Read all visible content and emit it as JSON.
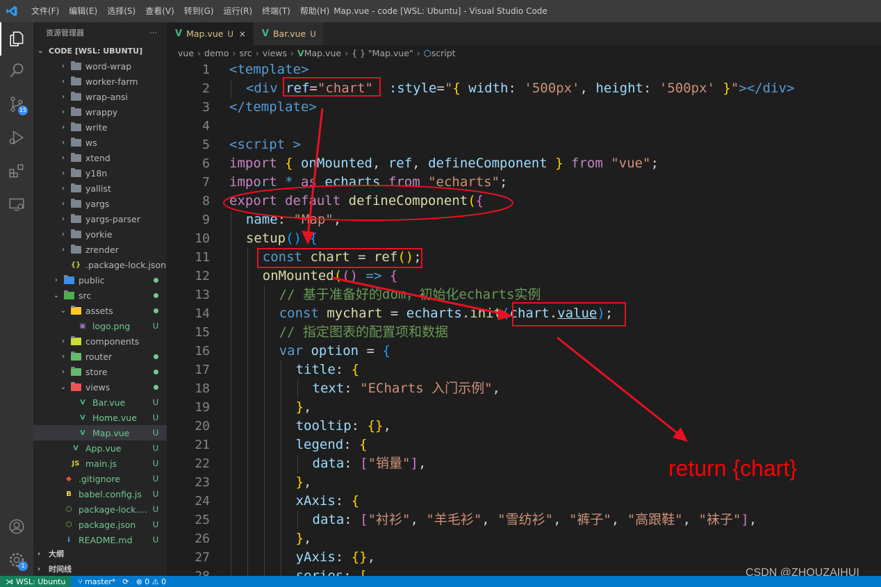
{
  "window": {
    "title": "Map.vue - code [WSL: Ubuntu] - Visual Studio Code",
    "menu": [
      "文件(F)",
      "编辑(E)",
      "选择(S)",
      "查看(V)",
      "转到(G)",
      "运行(R)",
      "终端(T)",
      "帮助(H)"
    ]
  },
  "activity": {
    "scm_badge": "15",
    "settings_badge": "1"
  },
  "sidebar": {
    "title": "资源管理器",
    "more": "···",
    "root": "CODE [WSL: UBUNTU]",
    "items": [
      {
        "name": "word-wrap",
        "type": "folder",
        "indent": 1
      },
      {
        "name": "worker-farm",
        "type": "folder",
        "indent": 1
      },
      {
        "name": "wrap-ansi",
        "type": "folder",
        "indent": 1
      },
      {
        "name": "wrappy",
        "type": "folder",
        "indent": 1
      },
      {
        "name": "write",
        "type": "folder",
        "indent": 1
      },
      {
        "name": "ws",
        "type": "folder",
        "indent": 1
      },
      {
        "name": "xtend",
        "type": "folder",
        "indent": 1
      },
      {
        "name": "y18n",
        "type": "folder",
        "indent": 1
      },
      {
        "name": "yallist",
        "type": "folder",
        "indent": 1
      },
      {
        "name": "yargs",
        "type": "folder",
        "indent": 1
      },
      {
        "name": "yargs-parser",
        "type": "folder",
        "indent": 1
      },
      {
        "name": "yorkie",
        "type": "folder",
        "indent": 1
      },
      {
        "name": "zrender",
        "type": "folder",
        "indent": 1
      },
      {
        "name": ".package-lock.json",
        "type": "json",
        "indent": 1
      },
      {
        "name": "public",
        "type": "folder-public",
        "indent": 0,
        "dot": true
      },
      {
        "name": "src",
        "type": "folder-src",
        "indent": 0,
        "open": true,
        "dot": true
      },
      {
        "name": "assets",
        "type": "folder-assets",
        "indent": 1,
        "open": true,
        "dot": true
      },
      {
        "name": "logo.png",
        "type": "image",
        "indent": 2,
        "badge": "U"
      },
      {
        "name": "components",
        "type": "folder-components",
        "indent": 1
      },
      {
        "name": "router",
        "type": "folder-router",
        "indent": 1,
        "dot": true
      },
      {
        "name": "store",
        "type": "folder-store",
        "indent": 1,
        "dot": true
      },
      {
        "name": "views",
        "type": "folder-views",
        "indent": 1,
        "open": true,
        "dot": true
      },
      {
        "name": "Bar.vue",
        "type": "vue",
        "indent": 2,
        "badge": "U"
      },
      {
        "name": "Home.vue",
        "type": "vue",
        "indent": 2,
        "badge": "U"
      },
      {
        "name": "Map.vue",
        "type": "vue",
        "indent": 2,
        "badge": "U",
        "selected": true
      },
      {
        "name": "App.vue",
        "type": "vue",
        "indent": 1,
        "badge": "U"
      },
      {
        "name": "main.js",
        "type": "js",
        "indent": 1,
        "badge": "U"
      },
      {
        "name": ".gitignore",
        "type": "git",
        "indent": 0,
        "badge": "U"
      },
      {
        "name": "babel.config.js",
        "type": "babel",
        "indent": 0,
        "badge": "U"
      },
      {
        "name": "package-lock.js...",
        "type": "npm",
        "indent": 0,
        "badge": "U"
      },
      {
        "name": "package.json",
        "type": "npm",
        "indent": 0,
        "badge": "U"
      },
      {
        "name": "README.md",
        "type": "info",
        "indent": 0,
        "badge": "U"
      }
    ],
    "outline": "大纲",
    "timeline": "时间线"
  },
  "tabs": [
    {
      "label": "Map.vue",
      "mod": "U",
      "close": "×",
      "active": true
    },
    {
      "label": "Bar.vue",
      "mod": "U",
      "active": false
    }
  ],
  "breadcrumb": [
    "vue",
    "demo",
    "src",
    "views",
    "Map.vue",
    "{ } \"Map.vue\"",
    "script"
  ],
  "code": [
    {
      "n": "1",
      "indent": 0,
      "t": [
        [
          "tg",
          "<template>"
        ]
      ]
    },
    {
      "n": "2",
      "indent": 1,
      "t": [
        [
          "tg",
          "<div "
        ],
        [
          "at",
          "ref"
        ],
        [
          "pn",
          "="
        ],
        [
          "st",
          "\"chart\""
        ],
        [
          "pn",
          "  "
        ],
        [
          "at",
          ":style"
        ],
        [
          "pn",
          "="
        ],
        [
          "st",
          "\""
        ],
        [
          "br1",
          "{"
        ],
        [
          "pr",
          " width"
        ],
        [
          "pn",
          ": "
        ],
        [
          "st",
          "'500px'"
        ],
        [
          "pn",
          ", "
        ],
        [
          "pr",
          "height"
        ],
        [
          "pn",
          ": "
        ],
        [
          "st",
          "'500px'"
        ],
        [
          "pn",
          " "
        ],
        [
          "br1",
          "}"
        ],
        [
          "st",
          "\""
        ],
        [
          "tg",
          "></div>"
        ]
      ]
    },
    {
      "n": "3",
      "indent": 0,
      "t": [
        [
          "tg",
          "</template>"
        ]
      ]
    },
    {
      "n": "4",
      "indent": 0,
      "t": []
    },
    {
      "n": "5",
      "indent": 0,
      "t": [
        [
          "tg",
          "<script >"
        ]
      ]
    },
    {
      "n": "6",
      "indent": 0,
      "t": [
        [
          "kw",
          "import"
        ],
        [
          "pn",
          " "
        ],
        [
          "br1",
          "{"
        ],
        [
          "pn",
          " "
        ],
        [
          "pr",
          "onMounted"
        ],
        [
          "pn",
          ", "
        ],
        [
          "pr",
          "ref"
        ],
        [
          "pn",
          ", "
        ],
        [
          "pr",
          "defineComponent"
        ],
        [
          "pn",
          " "
        ],
        [
          "br1",
          "}"
        ],
        [
          "pn",
          " "
        ],
        [
          "kw",
          "from"
        ],
        [
          "pn",
          " "
        ],
        [
          "st",
          "\"vue\""
        ],
        [
          "pn",
          ";"
        ]
      ]
    },
    {
      "n": "7",
      "indent": 0,
      "t": [
        [
          "kw",
          "import"
        ],
        [
          "pn",
          " "
        ],
        [
          "tg",
          "*"
        ],
        [
          "pn",
          " "
        ],
        [
          "kw",
          "as"
        ],
        [
          "pn",
          " "
        ],
        [
          "pr",
          "echarts"
        ],
        [
          "pn",
          " "
        ],
        [
          "kw",
          "from"
        ],
        [
          "pn",
          " "
        ],
        [
          "st",
          "\"echarts\""
        ],
        [
          "pn",
          ";"
        ]
      ]
    },
    {
      "n": "8",
      "indent": 0,
      "t": [
        [
          "kw",
          "export"
        ],
        [
          "pn",
          " "
        ],
        [
          "kw",
          "default"
        ],
        [
          "pn",
          " "
        ],
        [
          "fn",
          "defineComponent"
        ],
        [
          "br1",
          "("
        ],
        [
          "br2",
          "{"
        ]
      ]
    },
    {
      "n": "9",
      "indent": 1,
      "t": [
        [
          "pr",
          "name"
        ],
        [
          "pn",
          ": "
        ],
        [
          "st",
          "\"Map\""
        ],
        [
          "pn",
          ","
        ]
      ]
    },
    {
      "n": "10",
      "indent": 1,
      "t": [
        [
          "fn",
          "setup"
        ],
        [
          "br3",
          "()"
        ],
        [
          "pn",
          " "
        ],
        [
          "br3",
          "{"
        ]
      ]
    },
    {
      "n": "11",
      "indent": 2,
      "t": [
        [
          "tg",
          "const"
        ],
        [
          "pn",
          " "
        ],
        [
          "fn",
          "chart"
        ],
        [
          "pn",
          " = "
        ],
        [
          "fn",
          "ref"
        ],
        [
          "br1",
          "()"
        ],
        [
          "pn",
          ";"
        ]
      ]
    },
    {
      "n": "12",
      "indent": 2,
      "t": [
        [
          "fn",
          "onMounted"
        ],
        [
          "br1",
          "("
        ],
        [
          "br2",
          "()"
        ],
        [
          "pn",
          " "
        ],
        [
          "tg",
          "=>"
        ],
        [
          "pn",
          " "
        ],
        [
          "br2",
          "{"
        ]
      ]
    },
    {
      "n": "13",
      "indent": 3,
      "t": [
        [
          "cm",
          "// 基于准备好的dom，初始化echarts实例"
        ]
      ]
    },
    {
      "n": "14",
      "indent": 3,
      "t": [
        [
          "tg",
          "const"
        ],
        [
          "pn",
          " "
        ],
        [
          "fn",
          "mychart"
        ],
        [
          "pn",
          " = "
        ],
        [
          "pr",
          "echarts"
        ],
        [
          "pn",
          "."
        ],
        [
          "fn",
          "init"
        ],
        [
          "br3",
          "("
        ],
        [
          "pr",
          "chart"
        ],
        [
          "pn",
          "."
        ],
        [
          "pr",
          "value"
        ],
        [
          "br3",
          ")"
        ],
        [
          "pn",
          ";"
        ]
      ]
    },
    {
      "n": "15",
      "indent": 3,
      "t": [
        [
          "cm",
          "// 指定图表的配置项和数据"
        ]
      ]
    },
    {
      "n": "16",
      "indent": 3,
      "t": [
        [
          "tg",
          "var"
        ],
        [
          "pn",
          " "
        ],
        [
          "pr",
          "option"
        ],
        [
          "pn",
          " = "
        ],
        [
          "br3",
          "{"
        ]
      ]
    },
    {
      "n": "17",
      "indent": 4,
      "t": [
        [
          "pr",
          "title"
        ],
        [
          "pn",
          ": "
        ],
        [
          "br1",
          "{"
        ]
      ]
    },
    {
      "n": "18",
      "indent": 5,
      "t": [
        [
          "pr",
          "text"
        ],
        [
          "pn",
          ": "
        ],
        [
          "st",
          "\"ECharts 入门示例\""
        ],
        [
          "pn",
          ","
        ]
      ]
    },
    {
      "n": "19",
      "indent": 4,
      "t": [
        [
          "br1",
          "}"
        ],
        [
          "pn",
          ","
        ]
      ]
    },
    {
      "n": "20",
      "indent": 4,
      "t": [
        [
          "pr",
          "tooltip"
        ],
        [
          "pn",
          ": "
        ],
        [
          "br1",
          "{}"
        ],
        [
          "pn",
          ","
        ]
      ]
    },
    {
      "n": "21",
      "indent": 4,
      "t": [
        [
          "pr",
          "legend"
        ],
        [
          "pn",
          ": "
        ],
        [
          "br1",
          "{"
        ]
      ]
    },
    {
      "n": "22",
      "indent": 5,
      "t": [
        [
          "pr",
          "data"
        ],
        [
          "pn",
          ": "
        ],
        [
          "br2",
          "["
        ],
        [
          "st",
          "\"销量\""
        ],
        [
          "br2",
          "]"
        ],
        [
          "pn",
          ","
        ]
      ]
    },
    {
      "n": "23",
      "indent": 4,
      "t": [
        [
          "br1",
          "}"
        ],
        [
          "pn",
          ","
        ]
      ]
    },
    {
      "n": "24",
      "indent": 4,
      "t": [
        [
          "pr",
          "xAxis"
        ],
        [
          "pn",
          ": "
        ],
        [
          "br1",
          "{"
        ]
      ]
    },
    {
      "n": "25",
      "indent": 5,
      "t": [
        [
          "pr",
          "data"
        ],
        [
          "pn",
          ": "
        ],
        [
          "br2",
          "["
        ],
        [
          "st",
          "\"衬衫\""
        ],
        [
          "pn",
          ", "
        ],
        [
          "st",
          "\"羊毛衫\""
        ],
        [
          "pn",
          ", "
        ],
        [
          "st",
          "\"雪纺衫\""
        ],
        [
          "pn",
          ", "
        ],
        [
          "st",
          "\"裤子\""
        ],
        [
          "pn",
          ", "
        ],
        [
          "st",
          "\"高跟鞋\""
        ],
        [
          "pn",
          ", "
        ],
        [
          "st",
          "\"袜子\""
        ],
        [
          "br2",
          "]"
        ],
        [
          "pn",
          ","
        ]
      ]
    },
    {
      "n": "26",
      "indent": 4,
      "t": [
        [
          "br1",
          "}"
        ],
        [
          "pn",
          ","
        ]
      ]
    },
    {
      "n": "27",
      "indent": 4,
      "t": [
        [
          "pr",
          "yAxis"
        ],
        [
          "pn",
          ": "
        ],
        [
          "br1",
          "{}"
        ],
        [
          "pn",
          ","
        ]
      ]
    },
    {
      "n": "28",
      "indent": 4,
      "t": [
        [
          "pr",
          "series"
        ],
        [
          "pn",
          ": "
        ],
        [
          "br1",
          "["
        ]
      ]
    }
  ],
  "annotation": {
    "note": "return {chart}",
    "color": "#e81123"
  },
  "watermark": "CSDN @ZHOUZAIHUI",
  "status": {
    "remote": "WSL: Ubuntu",
    "branch": "master*",
    "sync": "⟳",
    "problems": "⊗ 0 ⚠ 0"
  },
  "colors": {
    "accent": "#007acc",
    "vue": "#41b883",
    "untracked": "#73c991",
    "modified": "#e2c08d"
  }
}
